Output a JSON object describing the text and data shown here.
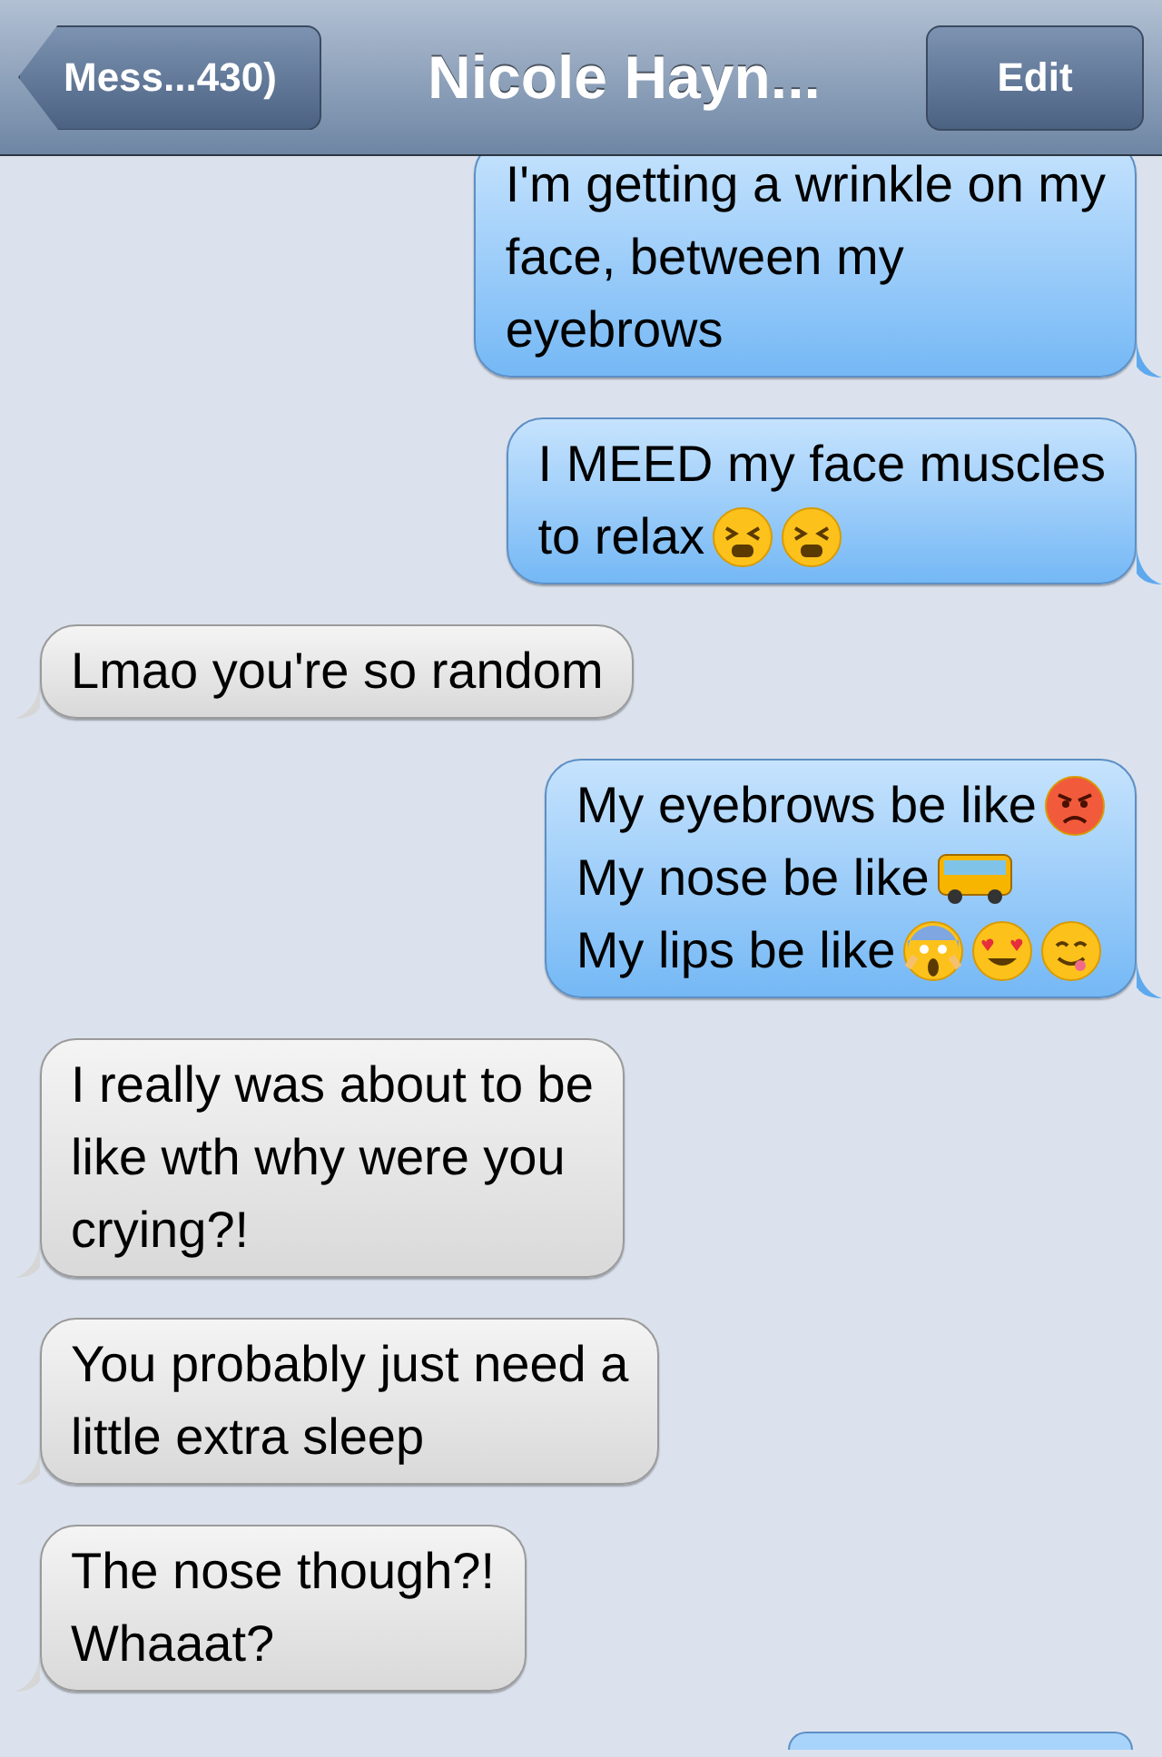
{
  "nav": {
    "back": "Mess...430)",
    "title": "Nicole Hayn...",
    "edit": "Edit"
  },
  "messages": [
    {
      "kind": "full",
      "outgoing": true,
      "lines": [
        {
          "text": "I'm getting a wrinkle on my"
        },
        {
          "text": "face, between my"
        },
        {
          "text": "eyebrows"
        }
      ]
    },
    {
      "kind": "full",
      "outgoing": true,
      "lines": [
        {
          "text": "I MEED my face muscles"
        },
        {
          "text": "to relax",
          "emoji": [
            {
              "kind": "tired"
            },
            {
              "kind": "tired"
            }
          ]
        }
      ]
    },
    {
      "kind": "full",
      "outgoing": false,
      "lines": [
        {
          "text": "Lmao you're so random"
        }
      ]
    },
    {
      "kind": "full",
      "outgoing": true,
      "lines": [
        {
          "text": "My eyebrows be like",
          "emoji": [
            {
              "kind": "angry"
            }
          ]
        },
        {
          "text": "My nose be like",
          "emoji": [
            {
              "kind": "bus"
            }
          ]
        },
        {
          "text": "My lips be like",
          "emoji": [
            {
              "kind": "scream"
            },
            {
              "kind": "heart-eyes"
            },
            {
              "kind": "yum"
            }
          ]
        }
      ]
    },
    {
      "kind": "full",
      "outgoing": false,
      "lines": [
        {
          "text": "I really was about to be"
        },
        {
          "text": "like wth why were you"
        },
        {
          "text": "crying?!"
        }
      ]
    },
    {
      "kind": "full",
      "outgoing": false,
      "lines": [
        {
          "text": "You probably just need a"
        },
        {
          "text": "little extra sleep"
        }
      ]
    },
    {
      "kind": "full",
      "outgoing": false,
      "lines": [
        {
          "text": "The nose though?!"
        },
        {
          "text": "Whaaat?"
        }
      ]
    },
    {
      "kind": "cut-off",
      "outgoing": true
    }
  ]
}
